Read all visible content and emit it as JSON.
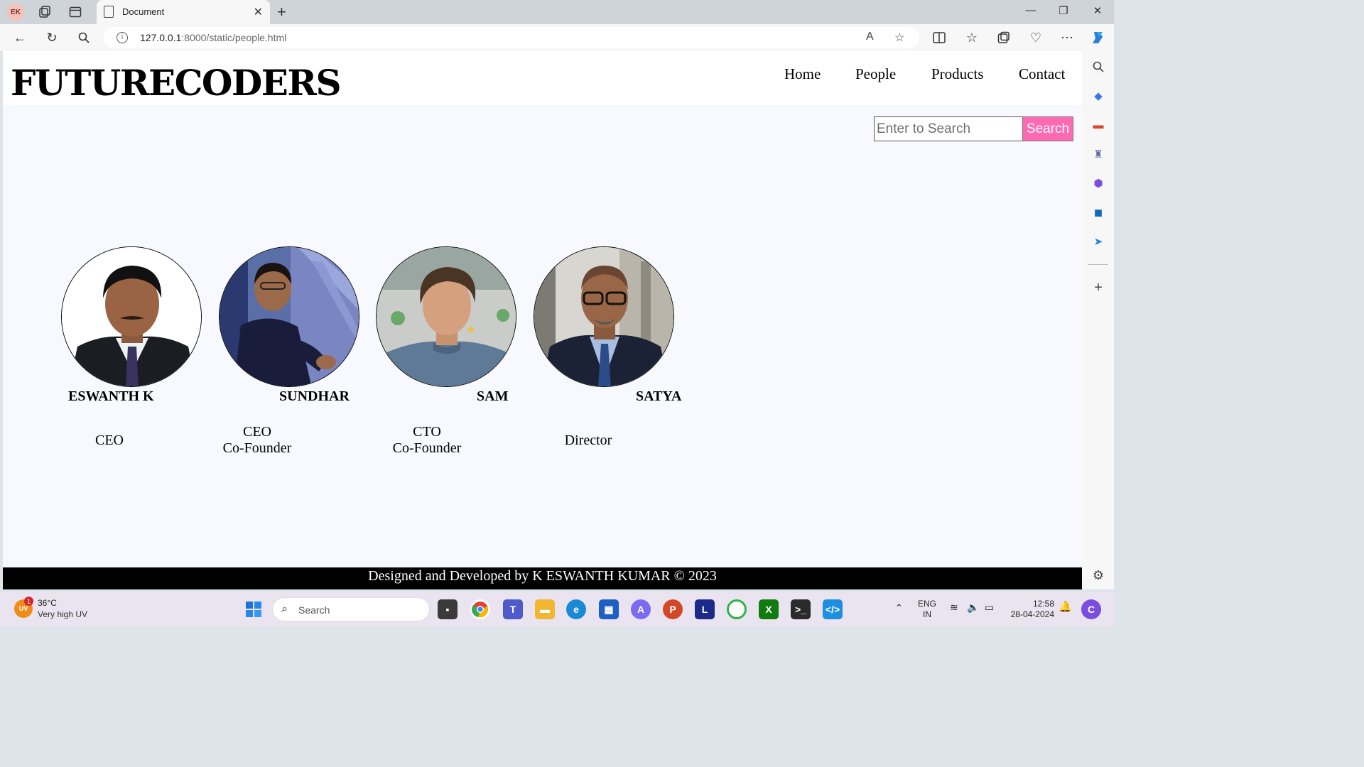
{
  "browser": {
    "profile_initials": "EK",
    "tab_title": "Document",
    "url_host": "127.0.0.1",
    "url_rest": ":8000/static/people.html"
  },
  "site": {
    "logo": "FUTURECODERS",
    "nav": [
      "Home",
      "People",
      "Products",
      "Contact"
    ],
    "search_placeholder": "Enter to Search",
    "search_button": "Search",
    "people": [
      {
        "name": "ESWANTH K",
        "role_lines": [
          "CEO"
        ]
      },
      {
        "name": "SUNDHAR",
        "role_lines": [
          "CEO",
          "Co-Founder"
        ]
      },
      {
        "name": "SAM",
        "role_lines": [
          "CTO",
          "Co-Founder"
        ]
      },
      {
        "name": "SATYA",
        "role_lines": [
          "Director"
        ]
      }
    ],
    "footer": "Designed and Developed by K ESWANTH KUMAR © 2023"
  },
  "taskbar": {
    "weather_temp": "36°C",
    "weather_desc": "Very high UV",
    "weather_badge": "1",
    "weather_icon_text": "UV",
    "search_label": "Search",
    "lang_1": "ENG",
    "lang_2": "IN",
    "time": "12:58",
    "date": "28-04-2024"
  },
  "colors": {
    "accent_search_button": "#ff69b4",
    "page_bg": "#f8f9fe",
    "footer_bg": "#000000"
  }
}
